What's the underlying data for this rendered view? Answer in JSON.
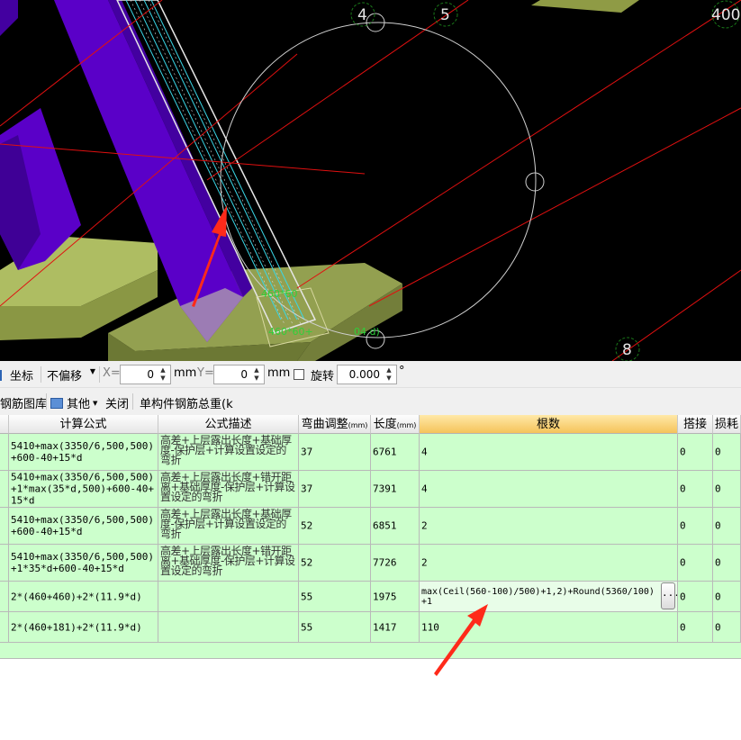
{
  "viewport": {
    "axis_labels": [
      "4",
      "5",
      "400",
      "8"
    ],
    "overlay_labels": [
      "460*60",
      "460*60+"
    ],
    "coord_text": "04 d)"
  },
  "toolbar1": {
    "coord_label": "坐标",
    "offset_mode": "不偏移",
    "x_label": "X=",
    "x_value": "0",
    "x_unit": "mm",
    "y_label": "Y=",
    "y_value": "0",
    "y_unit": "mm",
    "rotate_label": "旋转",
    "rotate_value": "0.000",
    "degree_symbol": "°"
  },
  "toolbar2": {
    "rebar_library": "钢筋图库",
    "other": "其他",
    "close": "关闭",
    "total_weight": "单构件钢筋总重(k"
  },
  "grid": {
    "columns": {
      "formula": "计算公式",
      "description": "公式描述",
      "bend_adjust": "弯曲调整",
      "bend_unit": "(mm)",
      "length": "长度",
      "length_unit": "(mm)",
      "count": "根数",
      "lap": "搭接",
      "loss": "损耗"
    },
    "rows": [
      {
        "formula": "5410+max(3350/6,500,500)+600-40+15*d",
        "description": "高差+上层露出长度+基础厚度-保护层+计算设置设定的弯折",
        "bend": "37",
        "length": "6761",
        "count": "4",
        "lap": "0",
        "loss": "0"
      },
      {
        "formula": "5410+max(3350/6,500,500)+1*max(35*d,500)+600-40+15*d",
        "description": "高差+上层露出长度+错开距离+基础厚度-保护层+计算设置设定的弯折",
        "bend": "37",
        "length": "7391",
        "count": "4",
        "lap": "0",
        "loss": "0"
      },
      {
        "formula": "5410+max(3350/6,500,500)+600-40+15*d",
        "description": "高差+上层露出长度+基础厚度-保护层+计算设置设定的弯折",
        "bend": "52",
        "length": "6851",
        "count": "2",
        "lap": "0",
        "loss": "0"
      },
      {
        "formula": "5410+max(3350/6,500,500)+1*35*d+600-40+15*d",
        "description": "高差+上层露出长度+错开距离+基础厚度-保护层+计算设置设定的弯折",
        "bend": "52",
        "length": "7726",
        "count": "2",
        "lap": "0",
        "loss": "0"
      },
      {
        "formula": "2*(460+460)+2*(11.9*d)",
        "description": "",
        "bend": "55",
        "length": "1975",
        "count": "max(Ceil(560-100)/500)+1,2)+Round(5360/100)+1",
        "lap": "0",
        "loss": "0"
      },
      {
        "formula": "2*(460+181)+2*(11.9*d)",
        "description": "",
        "bend": "55",
        "length": "1417",
        "count": "110",
        "lap": "0",
        "loss": "0"
      }
    ],
    "ellipsis": "..."
  },
  "colors": {
    "cell_bg": "#ccffcc",
    "active_header": "#f5c35a",
    "column_purple": "#5a00c8",
    "annotation_arrow": "#ff2a1a"
  }
}
